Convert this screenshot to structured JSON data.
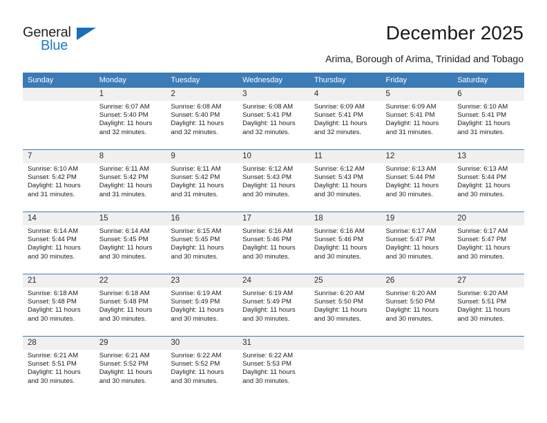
{
  "brand": {
    "name_part1": "General",
    "name_part2": "Blue",
    "triangle_color": "#1a6fb5",
    "blue_color": "#1c7cc4"
  },
  "header": {
    "title": "December 2025",
    "subtitle": "Arima, Borough of Arima, Trinidad and Tobago",
    "header_bg": "#3b7cb8",
    "daynum_bg": "#f0f0f0"
  },
  "weekday_headers": [
    "Sunday",
    "Monday",
    "Tuesday",
    "Wednesday",
    "Thursday",
    "Friday",
    "Saturday"
  ],
  "weeks": [
    [
      {
        "day": "",
        "blank": true,
        "sunrise": "",
        "sunset": "",
        "daylight_line1": "",
        "daylight_line2": ""
      },
      {
        "day": "1",
        "sunrise": "Sunrise: 6:07 AM",
        "sunset": "Sunset: 5:40 PM",
        "daylight_line1": "Daylight: 11 hours",
        "daylight_line2": "and 32 minutes."
      },
      {
        "day": "2",
        "sunrise": "Sunrise: 6:08 AM",
        "sunset": "Sunset: 5:40 PM",
        "daylight_line1": "Daylight: 11 hours",
        "daylight_line2": "and 32 minutes."
      },
      {
        "day": "3",
        "sunrise": "Sunrise: 6:08 AM",
        "sunset": "Sunset: 5:41 PM",
        "daylight_line1": "Daylight: 11 hours",
        "daylight_line2": "and 32 minutes."
      },
      {
        "day": "4",
        "sunrise": "Sunrise: 6:09 AM",
        "sunset": "Sunset: 5:41 PM",
        "daylight_line1": "Daylight: 11 hours",
        "daylight_line2": "and 32 minutes."
      },
      {
        "day": "5",
        "sunrise": "Sunrise: 6:09 AM",
        "sunset": "Sunset: 5:41 PM",
        "daylight_line1": "Daylight: 11 hours",
        "daylight_line2": "and 31 minutes."
      },
      {
        "day": "6",
        "sunrise": "Sunrise: 6:10 AM",
        "sunset": "Sunset: 5:41 PM",
        "daylight_line1": "Daylight: 11 hours",
        "daylight_line2": "and 31 minutes."
      }
    ],
    [
      {
        "day": "7",
        "sunrise": "Sunrise: 6:10 AM",
        "sunset": "Sunset: 5:42 PM",
        "daylight_line1": "Daylight: 11 hours",
        "daylight_line2": "and 31 minutes."
      },
      {
        "day": "8",
        "sunrise": "Sunrise: 6:11 AM",
        "sunset": "Sunset: 5:42 PM",
        "daylight_line1": "Daylight: 11 hours",
        "daylight_line2": "and 31 minutes."
      },
      {
        "day": "9",
        "sunrise": "Sunrise: 6:11 AM",
        "sunset": "Sunset: 5:42 PM",
        "daylight_line1": "Daylight: 11 hours",
        "daylight_line2": "and 31 minutes."
      },
      {
        "day": "10",
        "sunrise": "Sunrise: 6:12 AM",
        "sunset": "Sunset: 5:43 PM",
        "daylight_line1": "Daylight: 11 hours",
        "daylight_line2": "and 30 minutes."
      },
      {
        "day": "11",
        "sunrise": "Sunrise: 6:12 AM",
        "sunset": "Sunset: 5:43 PM",
        "daylight_line1": "Daylight: 11 hours",
        "daylight_line2": "and 30 minutes."
      },
      {
        "day": "12",
        "sunrise": "Sunrise: 6:13 AM",
        "sunset": "Sunset: 5:44 PM",
        "daylight_line1": "Daylight: 11 hours",
        "daylight_line2": "and 30 minutes."
      },
      {
        "day": "13",
        "sunrise": "Sunrise: 6:13 AM",
        "sunset": "Sunset: 5:44 PM",
        "daylight_line1": "Daylight: 11 hours",
        "daylight_line2": "and 30 minutes."
      }
    ],
    [
      {
        "day": "14",
        "sunrise": "Sunrise: 6:14 AM",
        "sunset": "Sunset: 5:44 PM",
        "daylight_line1": "Daylight: 11 hours",
        "daylight_line2": "and 30 minutes."
      },
      {
        "day": "15",
        "sunrise": "Sunrise: 6:14 AM",
        "sunset": "Sunset: 5:45 PM",
        "daylight_line1": "Daylight: 11 hours",
        "daylight_line2": "and 30 minutes."
      },
      {
        "day": "16",
        "sunrise": "Sunrise: 6:15 AM",
        "sunset": "Sunset: 5:45 PM",
        "daylight_line1": "Daylight: 11 hours",
        "daylight_line2": "and 30 minutes."
      },
      {
        "day": "17",
        "sunrise": "Sunrise: 6:16 AM",
        "sunset": "Sunset: 5:46 PM",
        "daylight_line1": "Daylight: 11 hours",
        "daylight_line2": "and 30 minutes."
      },
      {
        "day": "18",
        "sunrise": "Sunrise: 6:16 AM",
        "sunset": "Sunset: 5:46 PM",
        "daylight_line1": "Daylight: 11 hours",
        "daylight_line2": "and 30 minutes."
      },
      {
        "day": "19",
        "sunrise": "Sunrise: 6:17 AM",
        "sunset": "Sunset: 5:47 PM",
        "daylight_line1": "Daylight: 11 hours",
        "daylight_line2": "and 30 minutes."
      },
      {
        "day": "20",
        "sunrise": "Sunrise: 6:17 AM",
        "sunset": "Sunset: 5:47 PM",
        "daylight_line1": "Daylight: 11 hours",
        "daylight_line2": "and 30 minutes."
      }
    ],
    [
      {
        "day": "21",
        "sunrise": "Sunrise: 6:18 AM",
        "sunset": "Sunset: 5:48 PM",
        "daylight_line1": "Daylight: 11 hours",
        "daylight_line2": "and 30 minutes."
      },
      {
        "day": "22",
        "sunrise": "Sunrise: 6:18 AM",
        "sunset": "Sunset: 5:48 PM",
        "daylight_line1": "Daylight: 11 hours",
        "daylight_line2": "and 30 minutes."
      },
      {
        "day": "23",
        "sunrise": "Sunrise: 6:19 AM",
        "sunset": "Sunset: 5:49 PM",
        "daylight_line1": "Daylight: 11 hours",
        "daylight_line2": "and 30 minutes."
      },
      {
        "day": "24",
        "sunrise": "Sunrise: 6:19 AM",
        "sunset": "Sunset: 5:49 PM",
        "daylight_line1": "Daylight: 11 hours",
        "daylight_line2": "and 30 minutes."
      },
      {
        "day": "25",
        "sunrise": "Sunrise: 6:20 AM",
        "sunset": "Sunset: 5:50 PM",
        "daylight_line1": "Daylight: 11 hours",
        "daylight_line2": "and 30 minutes."
      },
      {
        "day": "26",
        "sunrise": "Sunrise: 6:20 AM",
        "sunset": "Sunset: 5:50 PM",
        "daylight_line1": "Daylight: 11 hours",
        "daylight_line2": "and 30 minutes."
      },
      {
        "day": "27",
        "sunrise": "Sunrise: 6:20 AM",
        "sunset": "Sunset: 5:51 PM",
        "daylight_line1": "Daylight: 11 hours",
        "daylight_line2": "and 30 minutes."
      }
    ],
    [
      {
        "day": "28",
        "sunrise": "Sunrise: 6:21 AM",
        "sunset": "Sunset: 5:51 PM",
        "daylight_line1": "Daylight: 11 hours",
        "daylight_line2": "and 30 minutes."
      },
      {
        "day": "29",
        "sunrise": "Sunrise: 6:21 AM",
        "sunset": "Sunset: 5:52 PM",
        "daylight_line1": "Daylight: 11 hours",
        "daylight_line2": "and 30 minutes."
      },
      {
        "day": "30",
        "sunrise": "Sunrise: 6:22 AM",
        "sunset": "Sunset: 5:52 PM",
        "daylight_line1": "Daylight: 11 hours",
        "daylight_line2": "and 30 minutes."
      },
      {
        "day": "31",
        "sunrise": "Sunrise: 6:22 AM",
        "sunset": "Sunset: 5:53 PM",
        "daylight_line1": "Daylight: 11 hours",
        "daylight_line2": "and 30 minutes."
      },
      {
        "day": "",
        "blank": true,
        "sunrise": "",
        "sunset": "",
        "daylight_line1": "",
        "daylight_line2": ""
      },
      {
        "day": "",
        "blank": true,
        "sunrise": "",
        "sunset": "",
        "daylight_line1": "",
        "daylight_line2": ""
      },
      {
        "day": "",
        "blank": true,
        "sunrise": "",
        "sunset": "",
        "daylight_line1": "",
        "daylight_line2": ""
      }
    ]
  ]
}
